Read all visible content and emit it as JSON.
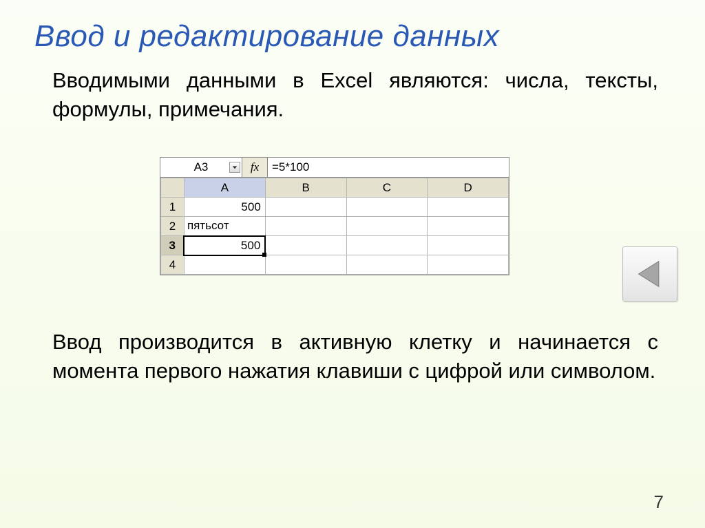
{
  "title": "Ввод и редактирование данных",
  "p1": "Вводимыми данными в Excel являются: числа, тексты, формулы, примечания.",
  "p2": "Ввод производится в активную клетку и начинается с момента первого нажатия клавиши с цифрой или символом.",
  "pagenum": "7",
  "excel": {
    "namebox": "A3",
    "fx": "fx",
    "formula": "=5*100",
    "cols": {
      "a": "A",
      "b": "B",
      "c": "C",
      "d": "D"
    },
    "rows": {
      "r1": "1",
      "r2": "2",
      "r3": "3",
      "r4": "4"
    },
    "cells": {
      "a1": "500",
      "a2": "пятьсот",
      "a3": "500"
    }
  }
}
